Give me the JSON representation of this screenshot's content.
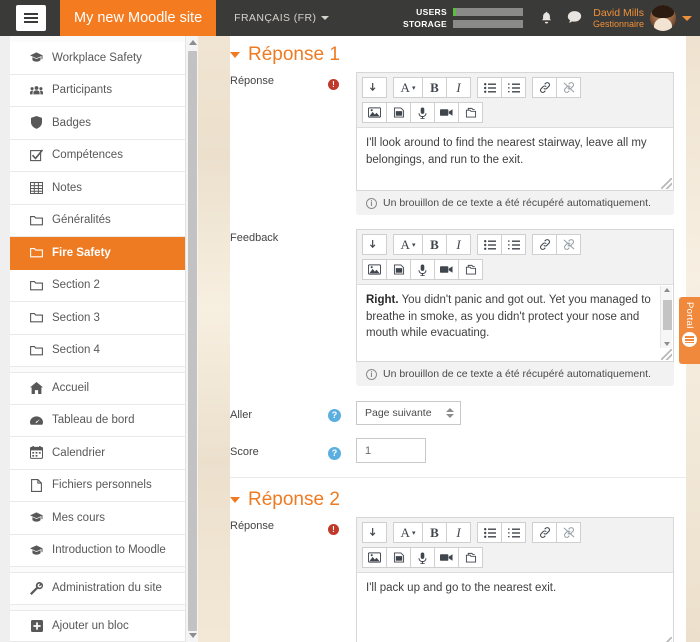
{
  "navbar": {
    "menu_icon": "hamburger-icon",
    "brand": "My new Moodle site",
    "language": "FRANÇAIS (FR)",
    "meters": [
      {
        "label": "USERS",
        "fill_percent": 4
      },
      {
        "label": "STORAGE",
        "fill_percent": 0
      }
    ],
    "notifications_icon": "bell-icon",
    "messages_icon": "chat-bubble-icon",
    "user_name": "David Mills",
    "user_role": "Gestionnaire"
  },
  "sidebar": {
    "items": [
      {
        "label": "Workplace Safety",
        "icon": "graduation-cap-icon",
        "active": false,
        "group_start": false
      },
      {
        "label": "Participants",
        "icon": "users-icon",
        "active": false,
        "group_start": false
      },
      {
        "label": "Badges",
        "icon": "shield-icon",
        "active": false,
        "group_start": false
      },
      {
        "label": "Compétences",
        "icon": "checkbox-icon",
        "active": false,
        "group_start": false
      },
      {
        "label": "Notes",
        "icon": "table-icon",
        "active": false,
        "group_start": false
      },
      {
        "label": "Généralités",
        "icon": "folder-icon",
        "active": false,
        "group_start": false
      },
      {
        "label": "Fire Safety",
        "icon": "folder-icon",
        "active": true,
        "group_start": false
      },
      {
        "label": "Section 2",
        "icon": "folder-icon",
        "active": false,
        "group_start": false
      },
      {
        "label": "Section 3",
        "icon": "folder-icon",
        "active": false,
        "group_start": false
      },
      {
        "label": "Section 4",
        "icon": "folder-icon",
        "active": false,
        "group_start": false
      },
      {
        "label": "Accueil",
        "icon": "home-icon",
        "active": false,
        "group_start": true
      },
      {
        "label": "Tableau de bord",
        "icon": "dashboard-icon",
        "active": false,
        "group_start": false
      },
      {
        "label": "Calendrier",
        "icon": "calendar-icon",
        "active": false,
        "group_start": false
      },
      {
        "label": "Fichiers personnels",
        "icon": "file-icon",
        "active": false,
        "group_start": false
      },
      {
        "label": "Mes cours",
        "icon": "graduation-cap-icon",
        "active": false,
        "group_start": false
      },
      {
        "label": "Introduction to Moodle",
        "icon": "graduation-cap-icon",
        "active": false,
        "group_start": false
      },
      {
        "label": "Administration du site",
        "icon": "wrench-icon",
        "active": false,
        "group_start": true
      },
      {
        "label": "Ajouter un bloc",
        "icon": "plus-square-icon",
        "active": false,
        "group_start": true
      }
    ]
  },
  "editor_toolbar": {
    "row1": [
      {
        "icon": "undo-icon",
        "glyph": "↲"
      },
      {
        "icon": "text-style-icon",
        "glyph": "A▾"
      },
      {
        "icon": "bold-icon",
        "glyph": "B"
      },
      {
        "icon": "italic-icon",
        "glyph": "I"
      },
      {
        "icon": "bullet-list-icon",
        "glyph": "☰"
      },
      {
        "icon": "numbered-list-icon",
        "glyph": "≣"
      },
      {
        "icon": "link-icon",
        "glyph": "🔗"
      },
      {
        "icon": "unlink-icon",
        "glyph": "⛓"
      }
    ],
    "row2": [
      {
        "icon": "image-icon",
        "glyph": "🖼"
      },
      {
        "icon": "media-icon",
        "glyph": "🎞"
      },
      {
        "icon": "microphone-icon",
        "glyph": "🎤"
      },
      {
        "icon": "video-camera-icon",
        "glyph": "🎥"
      },
      {
        "icon": "manage-files-icon",
        "glyph": "🗂"
      }
    ]
  },
  "main": {
    "sections": [
      {
        "title": "Réponse 1",
        "answer_label": "Réponse",
        "answer_text": "I'll look around to find the nearest stairway, leave all my belongings, and run to the exit.",
        "answer_draft_note": "Un brouillon de ce texte a été récupéré automatiquement.",
        "feedback_label": "Feedback",
        "feedback_bold": "Right.",
        "feedback_text": " You didn't panic and got out. Yet you managed to breathe in smoke, as you didn't protect your nose and mouth while evacuating.",
        "feedback_draft_note": "Un brouillon de ce texte a été récupéré automatiquement.",
        "jump_label": "Aller",
        "jump_value": "Page suivante",
        "score_label": "Score",
        "score_value": "1"
      },
      {
        "title": "Réponse 2",
        "answer_label": "Réponse",
        "answer_text": "I'll pack up and go to the nearest exit."
      }
    ]
  },
  "portal": {
    "label": "Portal",
    "logo_icon": "portal-logo-icon"
  },
  "colors": {
    "brand_orange": "#f47b20",
    "navbar_dark": "#3a3a38",
    "active_orange": "#ee7b22",
    "required_red": "#c0392b",
    "help_blue": "#5bafe0"
  }
}
